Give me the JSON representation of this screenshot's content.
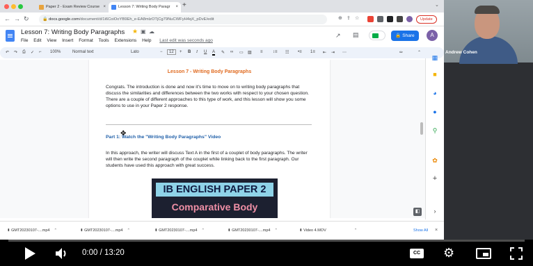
{
  "browser": {
    "tabs": [
      {
        "label": "Paper 2 - Exam Review Course",
        "active": false
      },
      {
        "label": "Lesson 7: Writing Body Paragr",
        "active": true
      }
    ],
    "new_tab": "+",
    "close_glyph": "×",
    "url_host": "docs.google.com",
    "url_path": "/document/d/1i6CoiOoYB9Eh_e-EA8mlzOTjCg79NuCWFyH4qX_pDvE/edit",
    "update_label": "Update"
  },
  "docs": {
    "title": "Lesson 7: Writing Body Paragraphs",
    "menu": [
      "File",
      "Edit",
      "View",
      "Insert",
      "Format",
      "Tools",
      "Extensions",
      "Help"
    ],
    "last_edit": "Last edit was seconds ago",
    "share_label": "Share",
    "account_initial": "A",
    "toolbar": {
      "zoom": "100%",
      "style": "Normal text",
      "font": "Lato",
      "font_size": "12",
      "bold": "B",
      "italic": "I",
      "underline": "U",
      "text_color": "A"
    }
  },
  "document": {
    "heading": "Lesson 7 - Writing Body Paragraphs",
    "para1": "Congrats.  The introduction is done and now it's time to move on to writing body paragraphs that discuss the similarities and differences between the two works with respect to your chosen question.  There are a couple of different approaches to this type of work, and this lesson will show you some options to use in your Paper 2 response.",
    "part1": "Part 1: Watch the \"Writing Body Paragraphs\" Video",
    "para2": "In this approach, the writer will discuss Text A in the first of a couplet of body paragraphs. The writer will then write the second paragraph of the couplet while linking back to the first paragraph.  Our students have used this approach with great success.",
    "cover_title": "IB ENGLISH PAPER 2",
    "cover_sub": "Comparative Body"
  },
  "downloads": {
    "items": [
      "GMT20230107-....mp4",
      "GMT20230107-....mp4",
      "GMT20230107-....mp4",
      "GMT20230107-....mp4",
      "Video 4.MOV"
    ],
    "show_all": "Show All"
  },
  "webcam": {
    "name": "Andrew Cohen"
  },
  "player": {
    "time": "0:00 / 13:20",
    "progress_fraction": 0,
    "cc_label": "CC"
  },
  "colors": {
    "accent_blue": "#1a73e8",
    "heading_orange": "#e06a1f",
    "progress_red": "#ff0000"
  }
}
